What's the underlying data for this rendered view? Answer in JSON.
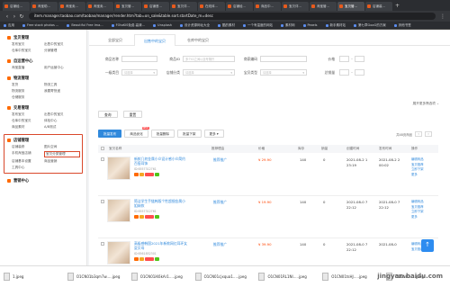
{
  "browser": {
    "tabs": [
      "店铺经...",
      "淘宝助...",
      "淘宝卖...",
      "淘宝卖...",
      "宝贝管...",
      "店铺首...",
      "宝贝详...",
      "在线体...",
      "店铺经...",
      "商品中...",
      "宝贝详...",
      "淘宝管...",
      "宝贝管...",
      "店铺装..."
    ],
    "url": "item.manager.taobao.com/taobao/manager/render.htm?tab=on_sale&table.sort.startDate_m=desc",
    "bookmarks": [
      "应用",
      "Free stock photos ...",
      "Beautiful Free Ima...",
      "FOtoKIS免费-高清...",
      "Unsplash",
      "设计资源网址大全",
      "酷的素材",
      "一个有温度的网站",
      "素材网",
      "Pexels",
      "新手素材站",
      "第七章GooG的方案",
      "其他书签"
    ]
  },
  "sidebar": {
    "sections": [
      {
        "title": "宝贝管理",
        "items": [
          "发布宝贝",
          "出售中的宝贝",
          "仓库中的宝贝",
          "分销管理"
        ]
      },
      {
        "title": "自运营中心",
        "items": [
          "淘宝直播",
          "用户运营中心"
        ]
      },
      {
        "title": "物流管理",
        "items": [
          "发货",
          "物流工具",
          "物流服务",
          "我要寄快递",
          "仓储服务"
        ]
      },
      {
        "title": "交易管理",
        "items": [
          "发布宝贝",
          "出售中的宝贝",
          "仓库中的宝贝",
          "体检中心",
          "商品素材",
          "A/B测试"
        ]
      }
    ],
    "highlight_section": {
      "title": "店铺管理",
      "items": [
        "店铺装修",
        "图片空间",
        "手机淘宝店铺",
        "宝贝分类管理",
        "店铺基本设置",
        "商品营销",
        "工具中心"
      ],
      "highlighted": "宝贝分类管理"
    },
    "last_section": {
      "title": "营销中心"
    }
  },
  "main": {
    "page_tabs": [
      "全部宝贝",
      "出售中的宝贝",
      "仓库中的宝贝"
    ],
    "filters": {
      "row1": {
        "label1": "商品名称",
        "placeholder1": "",
        "label2": "商品ID",
        "placeholder2": "多个ID之间以逗号隔开",
        "label3": "商家编码",
        "placeholder3": "",
        "label4": "价格"
      },
      "row2": {
        "label1": "一级类目",
        "placeholder1": "请选择",
        "label2": "店铺分类",
        "placeholder2": "请选择",
        "label3": "宝贝类型",
        "placeholder3": "请选择",
        "label4": "总销量"
      },
      "more": "展开更多筛选项"
    },
    "buttons": {
      "search": "查询",
      "reset": "重置"
    },
    "toolbar": {
      "buttons": [
        "批量发布",
        "商品优化",
        "批量删除",
        "批量下架",
        "更多"
      ],
      "badge": "NEW",
      "total": "共48页商品",
      "page": "1"
    },
    "table": {
      "headers": [
        "宝贝名称",
        "推荐理由",
        "价格",
        "库存",
        "销量",
        "创建时间",
        "发布时间",
        "操作"
      ],
      "rows": [
        {
          "title": "新款几何金属小众设计感小众简约百搭耳饰",
          "id": "ID:6557312761",
          "price": "¥ 29.90",
          "stock": "140",
          "sales": "0",
          "created": "2021-08-2 1 23:19",
          "published": "2021-08-2 2 00:02",
          "ops": [
            "编辑商品",
            "宝贝推荐",
            "立即下架",
            "更多"
          ],
          "reason": "推荐推广"
        },
        {
          "title": "简洁学生手链韩版个性超细金属小姐妹款",
          "id": "ID:6557312761",
          "price": "¥ 19.90",
          "stock": "140",
          "sales": "0",
          "created": "2021-08-0 7 22:12",
          "published": "2021-08-0 7 22:12",
          "ops": [
            "编辑商品",
            "宝贝推荐",
            "立即下架",
            "更多"
          ],
          "reason": "推荐推广"
        },
        {
          "title": "高级感韩国2021年新款网红耳环女夏贝母",
          "id": "ID:6561852301",
          "price": "¥ 39.90",
          "stock": "140",
          "sales": "0",
          "created": "2021-08-0 7 22:12",
          "published": "2021-08-0",
          "ops": [
            "编辑商品",
            "宝贝推荐"
          ],
          "reason": "推荐推广"
        }
      ]
    }
  },
  "downloads": [
    "1.jpeg",
    "O1CN01b3qm7w.....jpeg",
    "O1CN01iK6kAr1.....jpeg",
    "O1CN01cjxqua1.....jpeg",
    "O1CN01RL1NI.....jpeg",
    "O1CN01tsHJ.....jpeg",
    "O1CN01.....jpeg"
  ],
  "watermark": "jingyan.baidu.com"
}
